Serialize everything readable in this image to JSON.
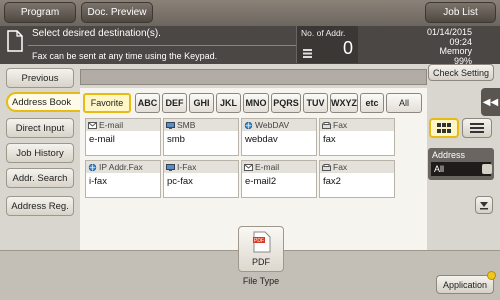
{
  "top": {
    "program": "Program",
    "doc_preview": "Doc. Preview",
    "job_list": "Job List"
  },
  "status": {
    "message": "Select desired destination(s).",
    "hint": "Fax can be sent at any time using the Keypad.",
    "addr_label": "No. of Addr.",
    "addr_count": "0",
    "date": "01/14/2015",
    "time": "09:24",
    "memory_label": "Memory",
    "memory_value": "99%"
  },
  "nav": {
    "previous": "Previous",
    "address_book": "Address Book",
    "direct_input": "Direct Input",
    "job_history": "Job History",
    "addr_search": "Addr. Search",
    "address_reg": "Address Reg."
  },
  "index": [
    "Favorite",
    "ABC",
    "DEF",
    "GHI",
    "JKL",
    "MNO",
    "PQRS",
    "TUV",
    "WXYZ",
    "etc",
    "All"
  ],
  "entries": [
    {
      "type": "E-mail",
      "name": "e-mail",
      "icon": "mail-icon"
    },
    {
      "type": "SMB",
      "name": "smb",
      "icon": "computer-icon"
    },
    {
      "type": "WebDAV",
      "name": "webdav",
      "icon": "globe-icon"
    },
    {
      "type": "Fax",
      "name": "fax",
      "icon": "fax-icon"
    },
    {
      "type": "IP Addr.Fax",
      "name": "i-fax",
      "icon": "globe-icon"
    },
    {
      "type": "I-Fax",
      "name": "pc-fax",
      "icon": "computer-icon"
    },
    {
      "type": "E-mail",
      "name": "e-mail2",
      "icon": "mail-icon"
    },
    {
      "type": "Fax",
      "name": "fax2",
      "icon": "fax-icon"
    }
  ],
  "right": {
    "check_setting": "Check Setting",
    "address_label": "Address",
    "address_value": "All"
  },
  "bottom": {
    "pdf_label": "PDF",
    "file_type": "File Type",
    "application": "Application"
  },
  "colors": {
    "accent": "#e6bb14",
    "dark_status": "#4a4744"
  }
}
